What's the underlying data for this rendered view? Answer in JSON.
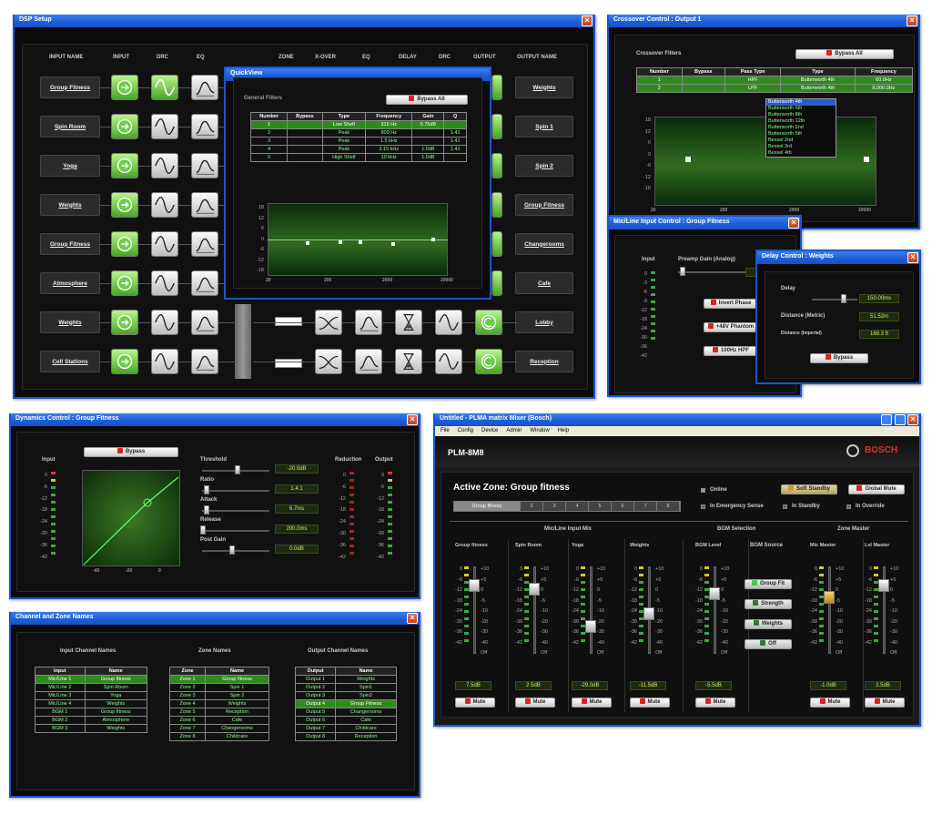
{
  "dsp": {
    "title": "DSP Setup",
    "headers": [
      "INPUT NAME",
      "INPUT",
      "DRC",
      "EQ",
      "ZONE",
      "X-OVER",
      "EQ",
      "DELAY",
      "DRC",
      "OUTPUT",
      "OUTPUT NAME"
    ],
    "inputs": [
      "Group Fitness",
      "Spin Room",
      "Yoga",
      "Weights",
      "Group Fitness",
      "Atmosphere",
      "Weights",
      "Cell Stations"
    ],
    "outputs": [
      "Weights",
      "Spin 1",
      "Spin 2",
      "Group Fitness",
      "Changerooms",
      "Cafe",
      "Lobby",
      "Reception"
    ]
  },
  "qv": {
    "title": "QuickView",
    "bypass": "Bypass All",
    "label": "General Filters",
    "cols": [
      "Number",
      "Bypass",
      "Type",
      "Frequency",
      "Gain",
      "Q"
    ],
    "rows": [
      [
        "1",
        "",
        "Low Shelf",
        "315 Hz",
        "0.75dB",
        ""
      ],
      [
        "2",
        "",
        "Peak",
        "800 Hz",
        "",
        "1.41"
      ],
      [
        "3",
        "",
        "Peak",
        "1.5 kHz",
        "",
        "1.41"
      ],
      [
        "4",
        "",
        "Peak",
        "3.15 kHz",
        "1.0dB",
        "1.41"
      ],
      [
        "5",
        "",
        "High Shelf",
        "10 kHz",
        "1.0dB",
        ""
      ]
    ],
    "y": [
      "18",
      "12",
      "6",
      "0",
      "-6",
      "-12",
      "-18"
    ],
    "x": [
      "20",
      "200",
      "2000",
      "20000"
    ]
  },
  "co": {
    "title": "Crossover Control : Output 1",
    "label": "Crossover Filters",
    "bypass": "Bypass All",
    "cols": [
      "Number",
      "Bypass",
      "Pass Type",
      "Type",
      "Frequency"
    ],
    "rows": [
      [
        "1",
        "",
        "HPF",
        "Butterworth 4th",
        "60.0Hz"
      ],
      [
        "2",
        "",
        "LPF",
        "Butterworth 4th",
        "8,000.0Hz"
      ]
    ],
    "opts": [
      "Butterworth 4th",
      "Butterworth 6th",
      "Butterworth 8th",
      "Butterworth 12th",
      "Butterworth 2nd",
      "Butterworth 5th",
      "Bessel 2nd",
      "Bessel 3rd",
      "Bessel 4th"
    ],
    "y": [
      "18",
      "12",
      "6",
      "0",
      "-6",
      "-12",
      "-18"
    ],
    "x": [
      "20",
      "200",
      "2000",
      "20000"
    ]
  },
  "mic": {
    "title": "Mic/Line Input Control : Group Fitness",
    "input": "Input",
    "gain": "Preamp Gain (Analog)",
    "btns": [
      "Invert Phase",
      "+48V Phantom",
      "100Hz HPF"
    ],
    "scale": [
      "0",
      "-3",
      "-6",
      "-9",
      "-12",
      "-18",
      "-24",
      "-30",
      "-36",
      "-42"
    ]
  },
  "delay": {
    "title": "Delay Control : Weights",
    "delay": "Delay",
    "dm": "Distance (Metric)",
    "di": "Distance (Imperial)",
    "v1": "150.00ms",
    "v2": "51.52m",
    "v3": "169.3 ft",
    "bypass": "Bypass"
  },
  "dyn": {
    "title": "Dynamics Control : Group Fitness",
    "bypass": "Bypass",
    "input": "Input",
    "red": "Reduction",
    "output": "Output",
    "params": [
      {
        "n": "Threshold",
        "v": "-20.0dB"
      },
      {
        "n": "Ratio",
        "v": "1.4:1"
      },
      {
        "n": "Attack",
        "v": "6.7ms"
      },
      {
        "n": "Release",
        "v": "200.0ms"
      },
      {
        "n": "Post Gain",
        "v": "0.0dB"
      }
    ],
    "scale": [
      "0",
      "-6",
      "-12",
      "-18",
      "-24",
      "-30",
      "-36",
      "-42"
    ],
    "gx": [
      "-40",
      "-20",
      "0"
    ]
  },
  "cz": {
    "title": "Channel and Zone Names",
    "h1": "Input Channel Names",
    "h2": "Zone Names",
    "h3": "Output Channel Names",
    "t1h": [
      "Input",
      "Name"
    ],
    "t1": [
      [
        "Mic/Line 1",
        "Group fitness"
      ],
      [
        "Mic/Line 2",
        "Spin Room"
      ],
      [
        "Mic/Line 3",
        "Yoga"
      ],
      [
        "Mic/Line 4",
        "Weights"
      ],
      [
        "BGM 1",
        "Group fitness"
      ],
      [
        "BGM 2",
        "Atmosphere"
      ],
      [
        "BGM 3",
        "Weights"
      ]
    ],
    "t2h": [
      "Zone",
      "Name"
    ],
    "t2": [
      [
        "Zone 1",
        "Group fitness"
      ],
      [
        "Zone 2",
        "Spin 1"
      ],
      [
        "Zone 3",
        "Spin 2"
      ],
      [
        "Zone 4",
        "Weights"
      ],
      [
        "Zone 5",
        "Reception"
      ],
      [
        "Zone 6",
        "Cafe"
      ],
      [
        "Zone 7",
        "Changerooms"
      ],
      [
        "Zone 8",
        "Childcare"
      ]
    ],
    "t3h": [
      "Output",
      "Name"
    ],
    "t3": [
      [
        "Output 1",
        "Weights"
      ],
      [
        "Output 2",
        "Spin1"
      ],
      [
        "Output 3",
        "Spin2"
      ],
      [
        "Output 4",
        "Group Fitness"
      ],
      [
        "Output 5",
        "Changerooms"
      ],
      [
        "Output 6",
        "Cafe"
      ],
      [
        "Output 7",
        "Childcare"
      ],
      [
        "Output 8",
        "Reception"
      ]
    ]
  },
  "plm": {
    "title": "Untitled - PLMA matrix Mixer (Bosch)",
    "menu": [
      "File",
      "Config",
      "Device",
      "Admin",
      "Window",
      "Help"
    ],
    "model": "PLM-8M8",
    "brand": "BOSCH",
    "zone": "Active Zone: Group fitness",
    "tabs": [
      "Group fitness",
      "2",
      "3",
      "4",
      "5",
      "6",
      "7",
      "8"
    ],
    "status": [
      "Online",
      "In Emergency Sense",
      "In Standby",
      "In Override"
    ],
    "soft": "Soft Standby",
    "glob": "Global Mute",
    "sec1": "Mic/Line Input Mix",
    "sec2": "BGM Selection",
    "sec3": "Zone Master",
    "ch": [
      {
        "n": "Group fitness",
        "v": "7.5dB"
      },
      {
        "n": "Spin Room",
        "v": "2.5dB"
      },
      {
        "n": "Yoga",
        "v": "-29.0dB"
      },
      {
        "n": "Weights",
        "v": "-11.5dB"
      },
      {
        "n": "BGM Level",
        "v": "-5.5dB"
      },
      {
        "n": "Mic Master",
        "v": "-1.0dB"
      },
      {
        "n": "Lvl Master",
        "v": "2.5dB"
      }
    ],
    "bgmsrc": "BGM Source",
    "bgm": [
      "Group Fit",
      "Strength",
      "Weights",
      "Off"
    ],
    "mute": "Mute",
    "scaleL": [
      "0",
      "-6",
      "-12",
      "-18",
      "-24",
      "-30",
      "-36",
      "-42"
    ],
    "scaleR": [
      "+10",
      "+5",
      "0",
      "-5",
      "-10",
      "-20",
      "-30",
      "-40",
      "Off"
    ]
  }
}
